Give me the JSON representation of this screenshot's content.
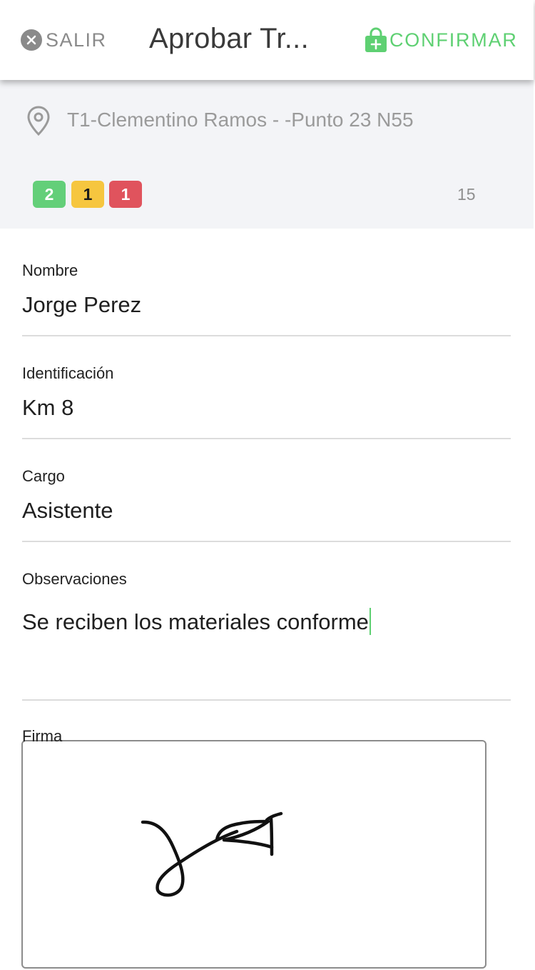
{
  "header": {
    "exit_label": "SALIR",
    "title": "Aprobar Tr...",
    "confirm_label": "CONFIRMAR",
    "accent_color": "#5ed072"
  },
  "summary": {
    "location": "T1-Clementino Ramos - -Punto 23 N55",
    "badges": [
      {
        "value": "2",
        "color": "#63cf79"
      },
      {
        "value": "1",
        "color": "#f6c63f"
      },
      {
        "value": "1",
        "color": "#e0535d"
      }
    ],
    "count": "15"
  },
  "form": {
    "nombre": {
      "label": "Nombre",
      "value": "Jorge Perez"
    },
    "identificacion": {
      "label": "Identificación",
      "value": "Km 8"
    },
    "cargo": {
      "label": "Cargo",
      "value": "Asistente"
    },
    "observaciones": {
      "label": "Observaciones",
      "value": "Se reciben los materiales conforme"
    },
    "firma": {
      "label": "Firma"
    }
  },
  "icons": {
    "exit": "close-circle-icon",
    "confirm": "shopping-bag-plus-icon",
    "location": "map-pin-icon"
  }
}
